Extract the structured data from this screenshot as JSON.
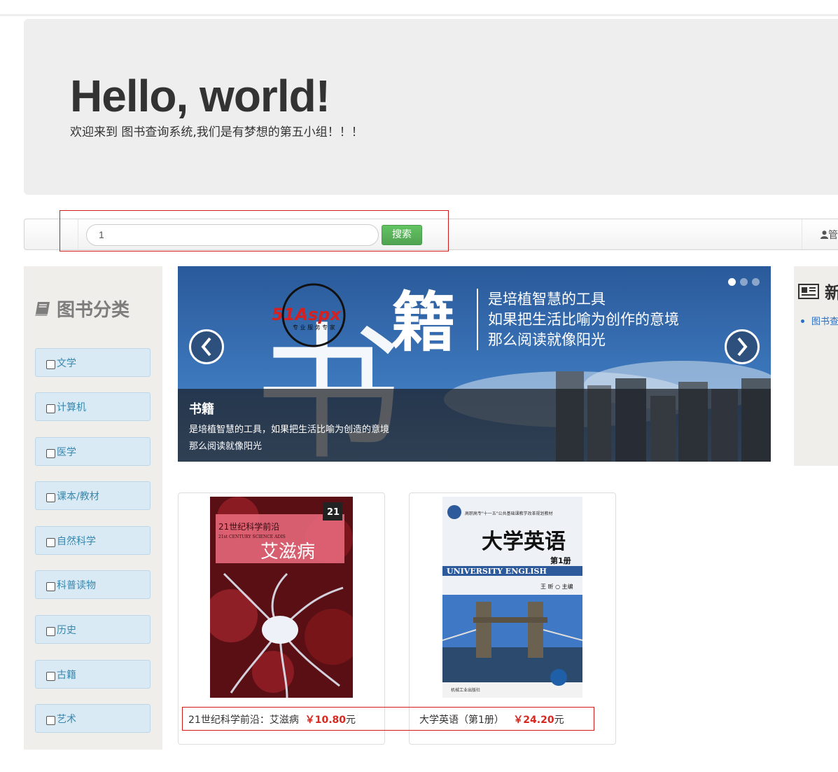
{
  "jumbotron": {
    "heading": "Hello, world!",
    "subtitle": "欢迎来到 图书查询系统,我们是有梦想的第五小组！！！"
  },
  "navbar": {
    "search_value": "1",
    "search_button": "搜索",
    "admin_label": "管"
  },
  "sidebar": {
    "title": "图书分类",
    "title_icon": "book-icon",
    "categories": [
      "文学",
      "计算机",
      "医学",
      "课本/教材",
      "自然科学",
      "科普读物",
      "历史",
      "古籍",
      "艺术"
    ]
  },
  "carousel": {
    "banner_big_char_1": "书",
    "banner_big_char_2": "籍",
    "banner_logo": "51Aspx",
    "banner_logo_sub": "专 业 服 务 专 家",
    "banner_lines": [
      "是培植智慧的工具",
      "如果把生活比喻为创作的意境",
      "那么阅读就像阳光"
    ],
    "caption_title": "书籍",
    "caption_line1": "是培植智慧的工具，如果把生活比喻为创造的意境",
    "caption_line2": "那么阅读就像阳光",
    "active_index": 0,
    "indicator_count": 3
  },
  "news": {
    "title": "新",
    "title_icon": "newspaper-icon",
    "link": "图书查"
  },
  "books": [
    {
      "name": "21世纪科学前沿：艾滋病",
      "price": "￥10.80",
      "unit": "元",
      "cover_top": "21世纪科学前沿",
      "cover_sub": "21st CENTURY SCIENCE ADIS",
      "cover_title": "艾滋病",
      "cover_badge": "21"
    },
    {
      "name": "大学英语（第1册）",
      "price": "￥24.20",
      "unit": "元",
      "cover_top": "高职高专\"十一五\"公共基础课教学改革规划教材",
      "cover_title": "大学英语",
      "cover_volume": "第1册",
      "cover_en": "UNIVERSITY ENGLISH",
      "cover_author": "王 昕 ○ 主编",
      "cover_publisher": "机械工业出版社"
    }
  ]
}
